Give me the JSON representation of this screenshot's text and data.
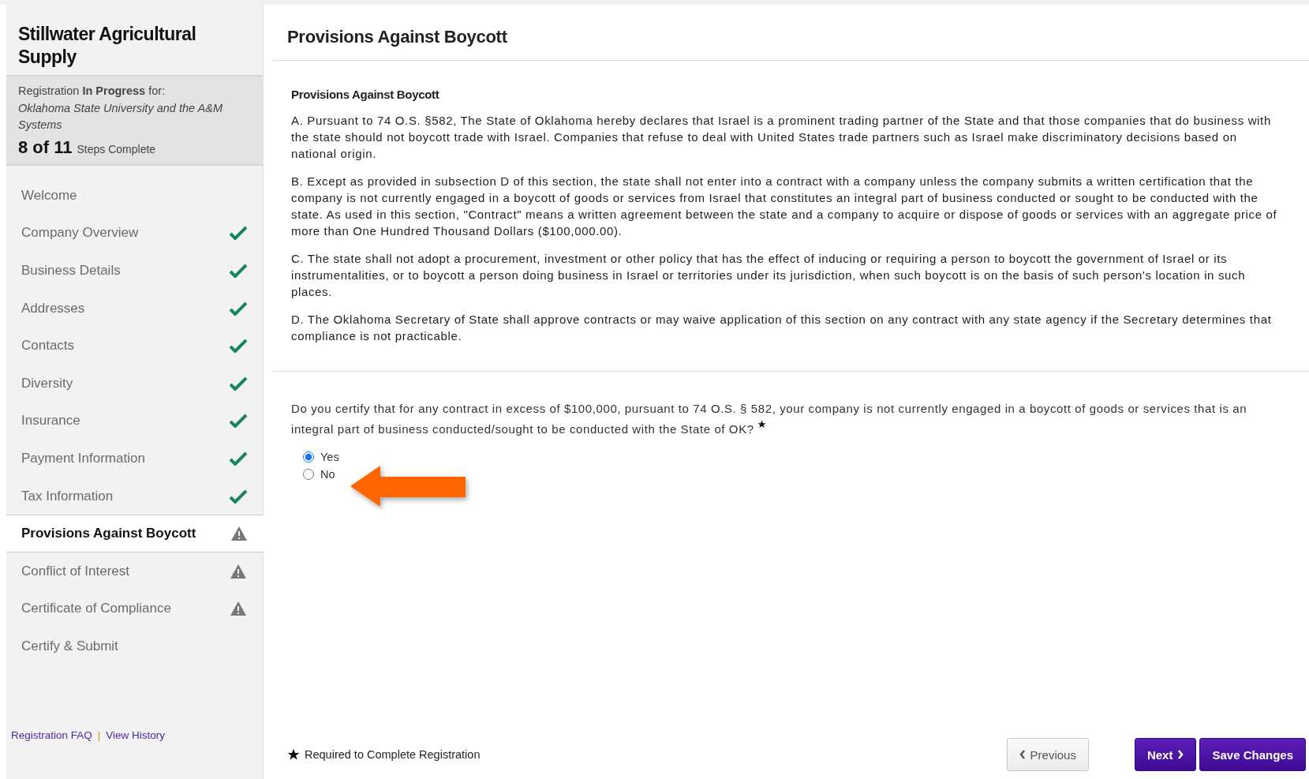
{
  "sidebar": {
    "company": "Stillwater Agricultural Supply",
    "registration": {
      "prefix": "Registration",
      "status": "In Progress",
      "suffix": "for:",
      "organization": "Oklahoma State University and the A&M Systems",
      "count": "8 of 11",
      "count_label": "Steps Complete"
    },
    "items": [
      {
        "label": "Welcome",
        "completed": false,
        "needs_attention": false,
        "selected": false
      },
      {
        "label": "Company Overview",
        "completed": true,
        "needs_attention": false,
        "selected": false
      },
      {
        "label": "Business Details",
        "completed": true,
        "needs_attention": false,
        "selected": false
      },
      {
        "label": "Addresses",
        "completed": true,
        "needs_attention": false,
        "selected": false
      },
      {
        "label": "Contacts",
        "completed": true,
        "needs_attention": false,
        "selected": false
      },
      {
        "label": "Diversity",
        "completed": true,
        "needs_attention": false,
        "selected": false
      },
      {
        "label": "Insurance",
        "completed": true,
        "needs_attention": false,
        "selected": false
      },
      {
        "label": "Payment Information",
        "completed": true,
        "needs_attention": false,
        "selected": false
      },
      {
        "label": "Tax Information",
        "completed": true,
        "needs_attention": false,
        "selected": false
      },
      {
        "label": "Provisions Against Boycott",
        "completed": false,
        "needs_attention": true,
        "selected": true
      },
      {
        "label": "Conflict of Interest",
        "completed": false,
        "needs_attention": true,
        "selected": false
      },
      {
        "label": "Certificate of Compliance",
        "completed": false,
        "needs_attention": true,
        "selected": false
      },
      {
        "label": "Certify & Submit",
        "completed": false,
        "needs_attention": false,
        "selected": false
      }
    ],
    "links": [
      "Registration FAQ",
      "View History"
    ],
    "separator": "|"
  },
  "main": {
    "title": "Provisions Against Boycott",
    "section_title": "Provisions Against Boycott",
    "paragraphs": [
      "A. Pursuant to 74 O.S. §582, The State of Oklahoma hereby declares that Israel is a prominent trading partner of the State and that those companies that do business with the state should not boycott trade with Israel. Companies that refuse to deal with United States trade partners such as Israel make discriminatory decisions based on national origin.",
      "B. Except as provided in subsection D of this section, the state shall not enter into a contract with a company unless the company submits a written certification that the company is not currently engaged in a boycott of goods or services from Israel that constitutes an integral part of business conducted or sought to be conducted with the state. As used in this section, \"Contract\" means a written agreement between the state and a company to acquire or dispose of goods or services with an aggregate price of more than One Hundred Thousand Dollars ($100,000.00).",
      "C. The state shall not adopt a procurement, investment or other policy that has the effect of inducing or requiring a person to boycott the government of Israel or its instrumentalities, or to boycott a person doing business in Israel or territories under its jurisdiction, when such boycott is on the basis of such person's location in such places.",
      "D. The Oklahoma Secretary of State shall approve contracts or may waive application of this section on any contract with any state agency if the Secretary determines that compliance is not practicable."
    ],
    "question": {
      "text": "Do you certify that for any contract in excess of $100,000, pursuant to 74 O.S. § 582, your company is not currently engaged in a boycott of goods or services that is an integral part of business conducted/sought to be conducted with the State of OK?",
      "required": true,
      "options": [
        {
          "label": "Yes",
          "selected": true
        },
        {
          "label": "No",
          "selected": false
        }
      ]
    },
    "required_note": "Required to Complete Registration",
    "buttons": [
      {
        "label": "Previous",
        "kind": "previous"
      },
      {
        "label": "Next",
        "kind": "next"
      },
      {
        "label": "Save Changes",
        "kind": "save"
      }
    ]
  }
}
